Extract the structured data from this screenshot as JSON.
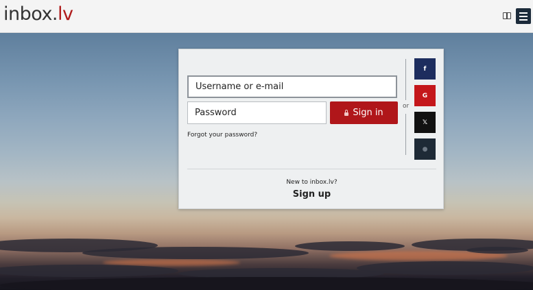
{
  "header": {
    "logo_part1": "inbox.",
    "logo_part2": "lv",
    "icons": [
      "book-icon",
      "menu-icon"
    ]
  },
  "login": {
    "username_placeholder": "Username or e-mail",
    "password_placeholder": "Password",
    "signin_label": "Sign in",
    "forgot_label": "Forgot your password?",
    "or_label": "or",
    "new_to_label": "New to inbox.lv?",
    "signup_label": "Sign up"
  },
  "social": [
    {
      "name": "facebook",
      "glyph": "f",
      "color": "#1d2d5e"
    },
    {
      "name": "google",
      "glyph": "G",
      "color": "#c4171b"
    },
    {
      "name": "x",
      "glyph": "𝕏",
      "color": "#111111"
    },
    {
      "name": "apple",
      "glyph": "",
      "color": "#1e2a36"
    }
  ],
  "colors": {
    "brand_red": "#b0161a",
    "header_bg": "#f4f4f4"
  }
}
